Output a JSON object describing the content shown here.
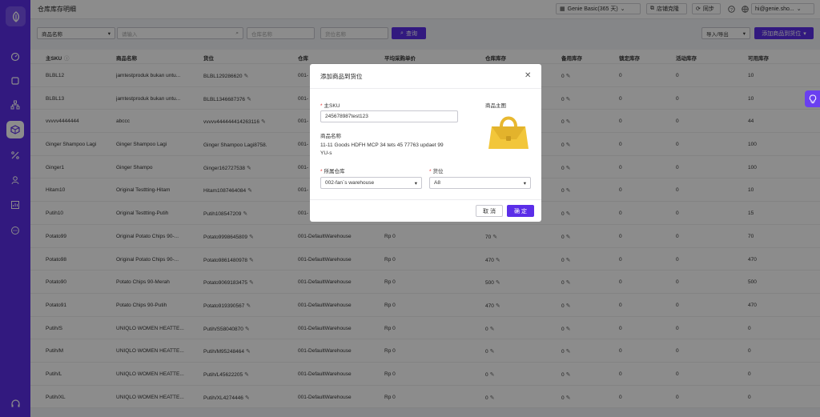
{
  "header": {
    "title": "仓库库存明细",
    "plan_label": "Genie Basic(365 天)",
    "shop_clone_label": "店铺克隆",
    "sync_label": "同步",
    "account_label": "hi@genie.sho..."
  },
  "filters": {
    "field_select": "商品名称",
    "search_placeholder": "请输入",
    "warehouse_placeholder": "仓库名称",
    "location_placeholder": "货位名称",
    "search_button": "查询",
    "import_export": "导入/导出",
    "add_button": "添加商品到货位"
  },
  "table": {
    "columns": [
      "主SKU",
      "商品名称",
      "货位",
      "仓库",
      "平均采购单价",
      "仓库库存",
      "备用库存",
      "锁定库存",
      "活动库存",
      "可用库存"
    ],
    "rows": [
      [
        "BLBL12",
        "jamtestproduk bukan untu...",
        "BLBL129286620",
        "001-",
        "",
        "",
        "0",
        "0",
        "0",
        "10"
      ],
      [
        "BLBL13",
        "jamtestproduk bukan untu...",
        "BLBL1346687376",
        "001-",
        "",
        "",
        "0",
        "0",
        "0",
        "10"
      ],
      [
        "vvvvv4444444",
        "abccc",
        "vvvvv444444414263116",
        "001-",
        "",
        "",
        "0",
        "0",
        "0",
        "44"
      ],
      [
        "Ginger Shampoo Lagi",
        "Ginger Shampoo Lagi",
        "Ginger Shampoo Lagi8758...",
        "001-",
        "",
        "",
        "0",
        "0",
        "0",
        "100"
      ],
      [
        "Ginger1",
        "Ginger Shampo",
        "Ginger162727538",
        "001-",
        "",
        "",
        "0",
        "0",
        "0",
        "100"
      ],
      [
        "Hitam10",
        "Original Testtting-Hitam",
        "Hitam1087464084",
        "001-",
        "",
        "",
        "0",
        "0",
        "0",
        "10"
      ],
      [
        "Putih10",
        "Original Testtting-Putih",
        "Putih108547209",
        "001-",
        "",
        "",
        "0",
        "0",
        "0",
        "15"
      ],
      [
        "Potato99",
        "Original Potato Chips 90-...",
        "Potato9998645809",
        "001-DefaultWarehouse",
        "Rp 0",
        "70",
        "0",
        "0",
        "0",
        "70"
      ],
      [
        "Potato98",
        "Original Potato Chips 90-...",
        "Potato9861480978",
        "001-DefaultWarehouse",
        "Rp 0",
        "470",
        "0",
        "0",
        "0",
        "470"
      ],
      [
        "Potato90",
        "Potato Chips 90-Merah",
        "Potato9069183475",
        "001-DefaultWarehouse",
        "Rp 0",
        "500",
        "0",
        "0",
        "0",
        "500"
      ],
      [
        "Potato91",
        "Potato Chips 90-Putih",
        "Potato919390567",
        "001-DefaultWarehouse",
        "Rp 0",
        "470",
        "0",
        "0",
        "0",
        "470"
      ],
      [
        "Putih/S",
        "UNIQLO WOMEN HEATTE...",
        "Putih/S58040870",
        "001-DefaultWarehouse",
        "Rp 0",
        "0",
        "0",
        "0",
        "0",
        "0"
      ],
      [
        "Putih/M",
        "UNIQLO WOMEN HEATTE...",
        "Putih/M95248464",
        "001-DefaultWarehouse",
        "Rp 0",
        "0",
        "0",
        "0",
        "0",
        "0"
      ],
      [
        "Putih/L",
        "UNIQLO WOMEN HEATTE...",
        "Putih/L45622205",
        "001-DefaultWarehouse",
        "Rp 0",
        "0",
        "0",
        "0",
        "0",
        "0"
      ],
      [
        "Putih/XL",
        "UNIQLO WOMEN HEATTE...",
        "Putih/XL4274446",
        "001-DefaultWarehouse",
        "Rp 0",
        "0",
        "0",
        "0",
        "0",
        "0"
      ]
    ]
  },
  "modal": {
    "title": "添加商品到货位",
    "sku_label": "主SKU",
    "sku_value": "245678987test123",
    "image_label": "商品主图",
    "name_label": "商品名称",
    "name_value": "11-11 Goods HDFH MCP 34 tets 45 77763 updaet 99 YU-s",
    "warehouse_label": "所属仓库",
    "warehouse_value": "002-fan`s warehouse",
    "location_label": "货位",
    "location_value": "A8",
    "cancel": "取 消",
    "confirm": "确 定"
  },
  "colors": {
    "primary": "#5b2ee8",
    "required": "#ee3333"
  }
}
